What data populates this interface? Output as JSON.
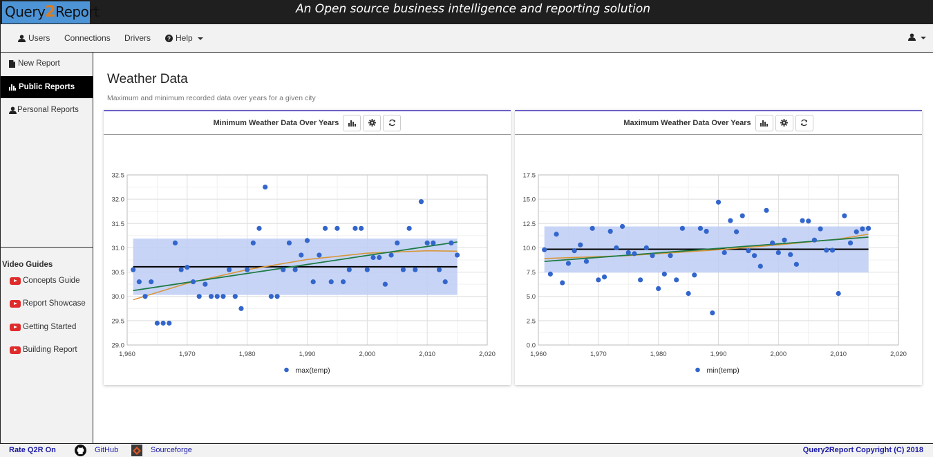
{
  "banner": {
    "logo": {
      "part1": "Query",
      "part2": "2",
      "part3": "Report"
    },
    "tagline": "An Open source business intelligence and reporting solution"
  },
  "nav": {
    "items": [
      {
        "label": "Users",
        "icon": "user-icon"
      },
      {
        "label": "Connections"
      },
      {
        "label": "Drivers"
      },
      {
        "label": "Help",
        "icon": "question-circle-icon",
        "dropdown": true
      }
    ],
    "account_icon": "user-icon"
  },
  "sidebar": {
    "items": [
      {
        "label": "New Report",
        "icon": "file-icon",
        "active": false
      },
      {
        "label": "Public Reports",
        "icon": "bar-chart-icon",
        "active": true
      },
      {
        "label": "Personal Reports",
        "icon": "user-icon",
        "active": false
      }
    ],
    "video_guides": {
      "title": "Video Guides",
      "items": [
        {
          "label": "Concepts Guide",
          "icon": "youtube-icon"
        },
        {
          "label": "Report Showcase",
          "icon": "youtube-icon"
        },
        {
          "label": "Getting Started",
          "icon": "youtube-icon"
        },
        {
          "label": "Building Report",
          "icon": "youtube-icon"
        }
      ]
    }
  },
  "main": {
    "title": "Weather Data",
    "subtitle": "Maximum and minimum recorded data over years for a given city",
    "panels": [
      {
        "title": "Minimum Weather Data Over Years",
        "buttons": [
          "bar-chart-icon",
          "gear-icon",
          "refresh-icon"
        ]
      },
      {
        "title": "Maximum Weather Data Over Years",
        "buttons": [
          "bar-chart-icon",
          "gear-icon",
          "refresh-icon"
        ]
      }
    ]
  },
  "footer": {
    "rate": "Rate Q2R On",
    "github": "GitHub",
    "sourceforge": "Sourceforge",
    "copyright": "Query2Report Copyright (C) 2018"
  },
  "colors": {
    "accent": "#6b5fc7",
    "point": "#3366cc",
    "band": "#bdccf4",
    "mean_line": "#000000",
    "linear_trend": "#1e7b45",
    "poly_trend": "#d9963a"
  },
  "chart_data": [
    {
      "type": "scatter",
      "title": "Minimum Weather Data Over Years",
      "series_name": "max(temp)",
      "xlim": [
        1960,
        2020
      ],
      "ylim": [
        29.0,
        32.5
      ],
      "xticks": [
        "1,960",
        "1,970",
        "1,980",
        "1,990",
        "2,000",
        "2,010",
        "2,020"
      ],
      "xtick_values": [
        1960,
        1970,
        1980,
        1990,
        2000,
        2010,
        2020
      ],
      "yticks": [
        "29.0",
        "29.5",
        "30.0",
        "30.5",
        "31.0",
        "31.5",
        "32.0",
        "32.5"
      ],
      "ytick_values": [
        29.0,
        29.5,
        30.0,
        30.5,
        31.0,
        31.5,
        32.0,
        32.5
      ],
      "grid": true,
      "legend": "bottom",
      "x": [
        1961,
        1962,
        1963,
        1964,
        1965,
        1966,
        1967,
        1968,
        1969,
        1970,
        1971,
        1972,
        1973,
        1974,
        1975,
        1976,
        1977,
        1978,
        1979,
        1980,
        1981,
        1982,
        1983,
        1984,
        1985,
        1986,
        1987,
        1988,
        1989,
        1990,
        1991,
        1992,
        1993,
        1994,
        1995,
        1996,
        1997,
        1998,
        1999,
        2000,
        2001,
        2002,
        2003,
        2004,
        2005,
        2006,
        2007,
        2008,
        2009,
        2010,
        2011,
        2012,
        2013,
        2014,
        2015
      ],
      "y": [
        30.55,
        30.3,
        30.0,
        30.3,
        29.45,
        29.45,
        29.45,
        31.1,
        30.55,
        30.6,
        30.3,
        30.0,
        30.25,
        30.0,
        30.0,
        30.0,
        30.55,
        30.0,
        29.75,
        30.55,
        31.1,
        31.4,
        32.25,
        30.0,
        30.0,
        30.55,
        31.1,
        30.55,
        30.85,
        31.15,
        30.3,
        30.85,
        31.4,
        30.3,
        31.4,
        30.3,
        30.55,
        31.4,
        31.4,
        30.55,
        30.8,
        30.8,
        30.25,
        30.85,
        31.1,
        30.55,
        31.4,
        30.55,
        31.95,
        31.1,
        31.1,
        30.55,
        30.3,
        31.1,
        30.85
      ],
      "mean": 30.61,
      "band": [
        30.03,
        31.19
      ],
      "linear_trend": {
        "start": [
          1961,
          30.12
        ],
        "end": [
          2015,
          31.12
        ]
      },
      "poly_trend": [
        [
          1961,
          29.93
        ],
        [
          1970,
          30.27
        ],
        [
          1980,
          30.55
        ],
        [
          1990,
          30.76
        ],
        [
          2000,
          30.89
        ],
        [
          2010,
          30.94
        ],
        [
          2015,
          30.93
        ]
      ]
    },
    {
      "type": "scatter",
      "title": "Maximum Weather Data Over Years",
      "series_name": "min(temp)",
      "xlim": [
        1960,
        2020
      ],
      "ylim": [
        0.0,
        17.5
      ],
      "xticks": [
        "1,960",
        "1,970",
        "1,980",
        "1,990",
        "2,000",
        "2,010",
        "2,020"
      ],
      "xtick_values": [
        1960,
        1970,
        1980,
        1990,
        2000,
        2010,
        2020
      ],
      "yticks": [
        "0.0",
        "2.5",
        "5.0",
        "7.5",
        "10.0",
        "12.5",
        "15.0",
        "17.5"
      ],
      "ytick_values": [
        0.0,
        2.5,
        5.0,
        7.5,
        10.0,
        12.5,
        15.0,
        17.5
      ],
      "grid": true,
      "legend": "bottom",
      "x": [
        1961,
        1962,
        1963,
        1964,
        1965,
        1966,
        1967,
        1968,
        1969,
        1970,
        1971,
        1972,
        1973,
        1974,
        1975,
        1976,
        1977,
        1978,
        1979,
        1980,
        1981,
        1982,
        1983,
        1984,
        1985,
        1986,
        1987,
        1988,
        1989,
        1990,
        1991,
        1992,
        1993,
        1994,
        1995,
        1996,
        1997,
        1998,
        1999,
        2000,
        2001,
        2002,
        2003,
        2004,
        2005,
        2006,
        2007,
        2008,
        2009,
        2010,
        2011,
        2012,
        2013,
        2014,
        2015
      ],
      "y": [
        9.8,
        7.3,
        11.4,
        6.4,
        8.4,
        9.7,
        10.3,
        8.6,
        12.0,
        6.7,
        7.0,
        11.7,
        10.0,
        12.2,
        9.5,
        9.4,
        6.7,
        10.0,
        9.2,
        5.8,
        7.3,
        9.2,
        6.7,
        12.0,
        5.3,
        7.2,
        12.0,
        11.7,
        3.3,
        14.7,
        9.5,
        12.8,
        11.65,
        13.3,
        9.7,
        9.2,
        8.1,
        13.85,
        10.5,
        9.5,
        10.8,
        9.3,
        8.3,
        12.8,
        12.75,
        10.8,
        11.95,
        9.75,
        9.75,
        5.3,
        13.3,
        10.5,
        11.65,
        11.95,
        12.0
      ],
      "mean": 9.85,
      "band": [
        7.45,
        12.2
      ],
      "linear_trend": {
        "start": [
          1961,
          8.6
        ],
        "end": [
          2015,
          11.1
        ]
      },
      "poly_trend": [
        [
          1961,
          8.9
        ],
        [
          1975,
          9.2
        ],
        [
          1990,
          9.8
        ],
        [
          2000,
          10.3
        ],
        [
          2010,
          10.9
        ],
        [
          2015,
          11.4
        ]
      ]
    }
  ]
}
